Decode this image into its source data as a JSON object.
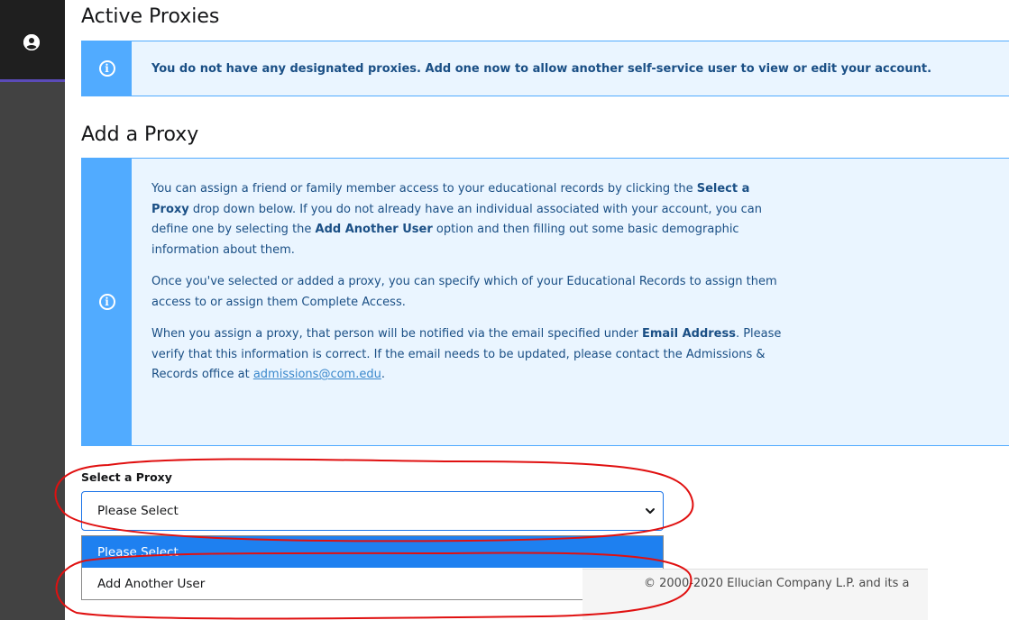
{
  "nav": {
    "avatar_icon": "user-circle-icon"
  },
  "active_proxies": {
    "title": "Active Proxies",
    "message": "You do not have any designated proxies. Add one now to allow another self-service user to view or edit your account."
  },
  "add_proxy": {
    "title": "Add a Proxy",
    "p1": [
      "You can assign a friend or family member access to your educational records by clicking the ",
      "Select a Proxy",
      " drop down below. If you do not already have an individual associated with your account, you can define one by selecting the ",
      "Add Another User",
      " option and then filling out some basic demographic information about them."
    ],
    "p2": "Once you've selected or added a proxy, you can specify which of your Educational Records to assign them access to or assign them Complete Access.",
    "p3": [
      "When you assign a proxy, that person will be notified via the email specified under ",
      "Email Address",
      ". Please verify that this information is correct. If the email needs to be updated, please contact the Admissions & Records office at ",
      "admissions@com.edu",
      "."
    ]
  },
  "select_proxy": {
    "label": "Select a Proxy",
    "value": "Please Select",
    "options": [
      "Please Select",
      "Add Another User"
    ]
  },
  "footer": {
    "copyright": "© 2000-2020 Ellucian Company L.P. and its a"
  },
  "colors": {
    "info_blue": "#51abff",
    "info_bg": "#eaf5ff",
    "selected_option": "#1e80f0",
    "annotation_red": "#e01010"
  }
}
